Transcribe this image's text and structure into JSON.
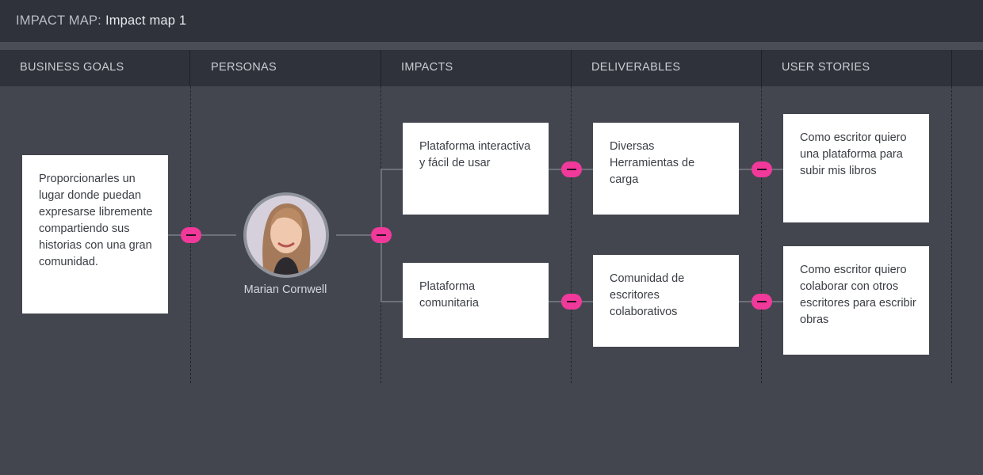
{
  "header": {
    "prefix": "IMPACT MAP:",
    "map_name": "Impact map 1"
  },
  "columns": [
    {
      "label": "BUSINESS GOALS"
    },
    {
      "label": "PERSONAS"
    },
    {
      "label": "IMPACTS"
    },
    {
      "label": "DELIVERABLES"
    },
    {
      "label": "USER STORIES"
    }
  ],
  "business_goal": {
    "text": "Proporcionarles un lugar donde puedan expresarse libremente compartiendo sus historias con una gran comunidad."
  },
  "persona": {
    "name": "Marian Cornwell"
  },
  "impacts": [
    {
      "text": "Plataforma interactiva y fácil de usar"
    },
    {
      "text": "Plataforma comunitaria"
    }
  ],
  "deliverables": [
    {
      "text": "Diversas Herramientas de carga"
    },
    {
      "text": "Comunidad de escritores colaborativos"
    }
  ],
  "user_stories": [
    {
      "text": "Como escritor quiero una plataforma para subir mis libros"
    },
    {
      "text": "Como escritor quiero colaborar con otros escritores para escribir obras"
    }
  ],
  "colors": {
    "background": "#43464f",
    "header": "#2f323a",
    "accent": "#f0399a",
    "card": "#ffffff"
  },
  "icons": {
    "collapse": "minus-toggle-icon"
  }
}
